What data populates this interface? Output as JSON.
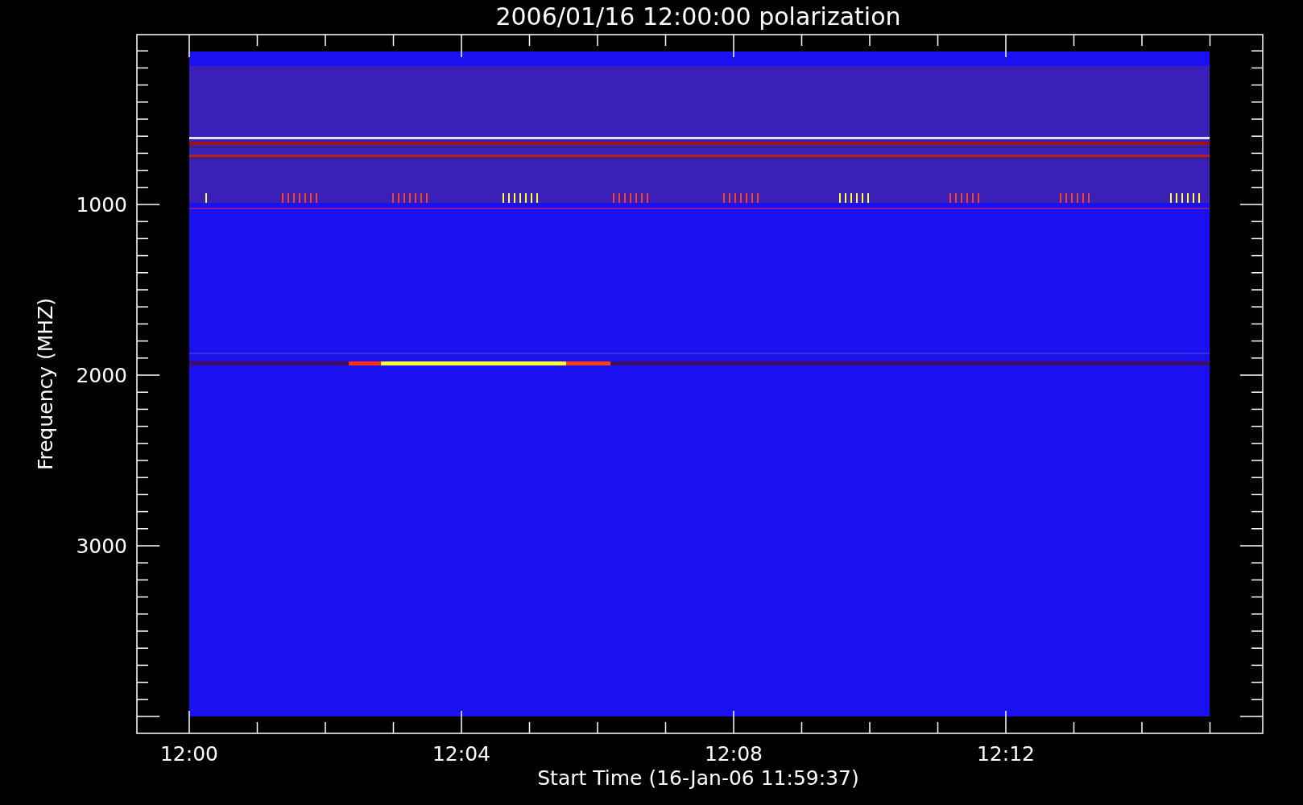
{
  "plot": {
    "title": "2006/01/16 12:00:00 polarization",
    "xlabel": "Start Time (16-Jan-06 11:59:37)",
    "ylabel": "Frequency (MHZ)",
    "xticks": [
      "12:00",
      "12:04",
      "12:08",
      "12:12"
    ],
    "yticks": [
      "1000",
      "2000",
      "3000"
    ]
  }
}
